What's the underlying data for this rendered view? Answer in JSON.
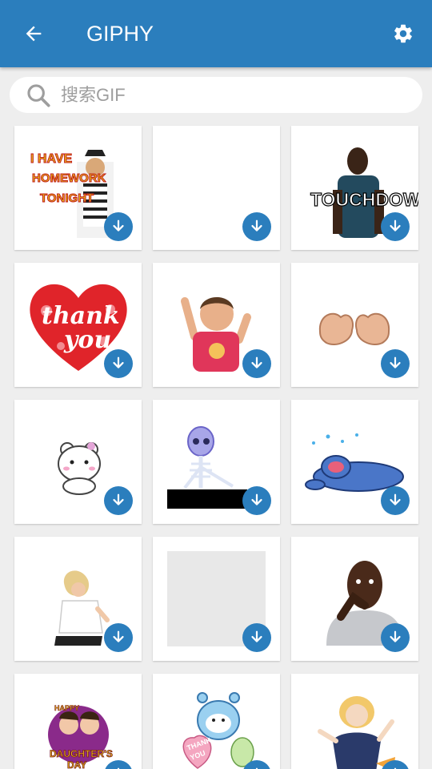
{
  "appbar": {
    "title": "GIPHY",
    "back_icon": "arrow-left-icon",
    "settings_icon": "gear-icon",
    "color": "#2b7ebd"
  },
  "search": {
    "placeholder": "搜索GIF",
    "value": "",
    "icon": "search-icon"
  },
  "stickers": [
    {
      "name": "homework-sticker",
      "caption": "I HAVE HOMEWORK TONIGHT"
    },
    {
      "name": "blank-sticker",
      "caption": ""
    },
    {
      "name": "touchdown-sticker",
      "caption": "TOUCHDOWN"
    },
    {
      "name": "thank-you-heart-sticker",
      "caption": "thank you"
    },
    {
      "name": "baby-cheering-sticker",
      "caption": ""
    },
    {
      "name": "fist-heart-sticker",
      "caption": ""
    },
    {
      "name": "white-bear-sticker",
      "caption": ""
    },
    {
      "name": "skeleton-waiting-sticker",
      "caption": ""
    },
    {
      "name": "stitch-crying-sticker",
      "caption": ""
    },
    {
      "name": "woman-dancing-sticker",
      "caption": ""
    },
    {
      "name": "loading-placeholder-sticker",
      "caption": ""
    },
    {
      "name": "man-thinking-sticker",
      "caption": ""
    },
    {
      "name": "daughters-day-sticker",
      "caption": "HAPPY DAUGHTER'S DAY"
    },
    {
      "name": "bear-thank-you-sticker",
      "caption": "THANK YOU"
    },
    {
      "name": "girl-cheering-sticker",
      "caption": ""
    }
  ],
  "download_icon": "download-icon"
}
